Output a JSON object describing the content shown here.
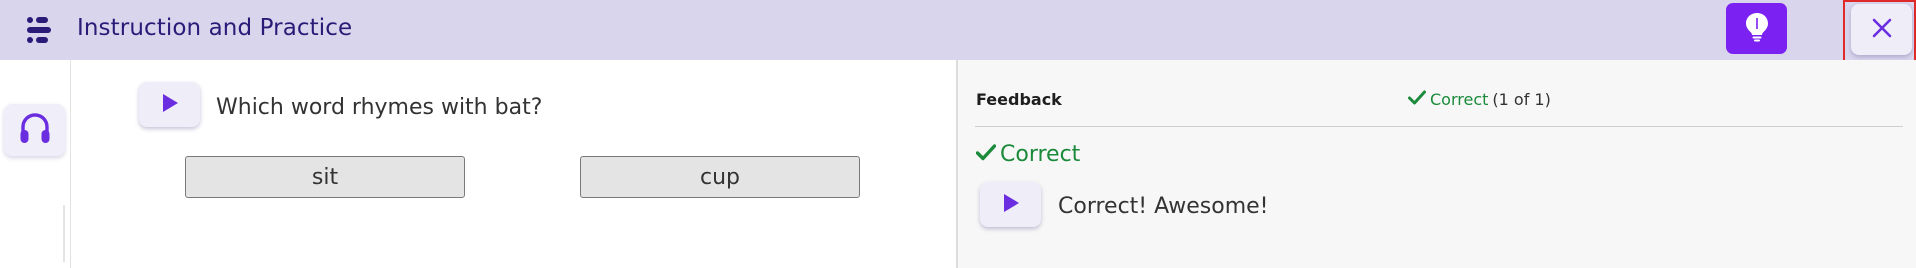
{
  "header": {
    "title": "Instruction and Practice",
    "icons": {
      "menu": "list-menu-icon",
      "hint": "lightbulb-icon",
      "close": "close-icon"
    }
  },
  "left_rail": {
    "audio_icon": "headphones-icon"
  },
  "question": {
    "text": "Which word rhymes with bat?",
    "play_icon": "play-icon",
    "answers": [
      "sit",
      "cup"
    ]
  },
  "feedback": {
    "header_label": "Feedback",
    "status_label": "Correct",
    "status_count": "(1 of 1)",
    "result_title": "Correct",
    "message": "Correct! Awesome!"
  },
  "colors": {
    "topbar": "#d8d5ec",
    "title_text": "#2a1b78",
    "accent_purple": "#7b22f2",
    "success_green": "#1b8a3a",
    "highlight_red": "#e02a2a"
  }
}
